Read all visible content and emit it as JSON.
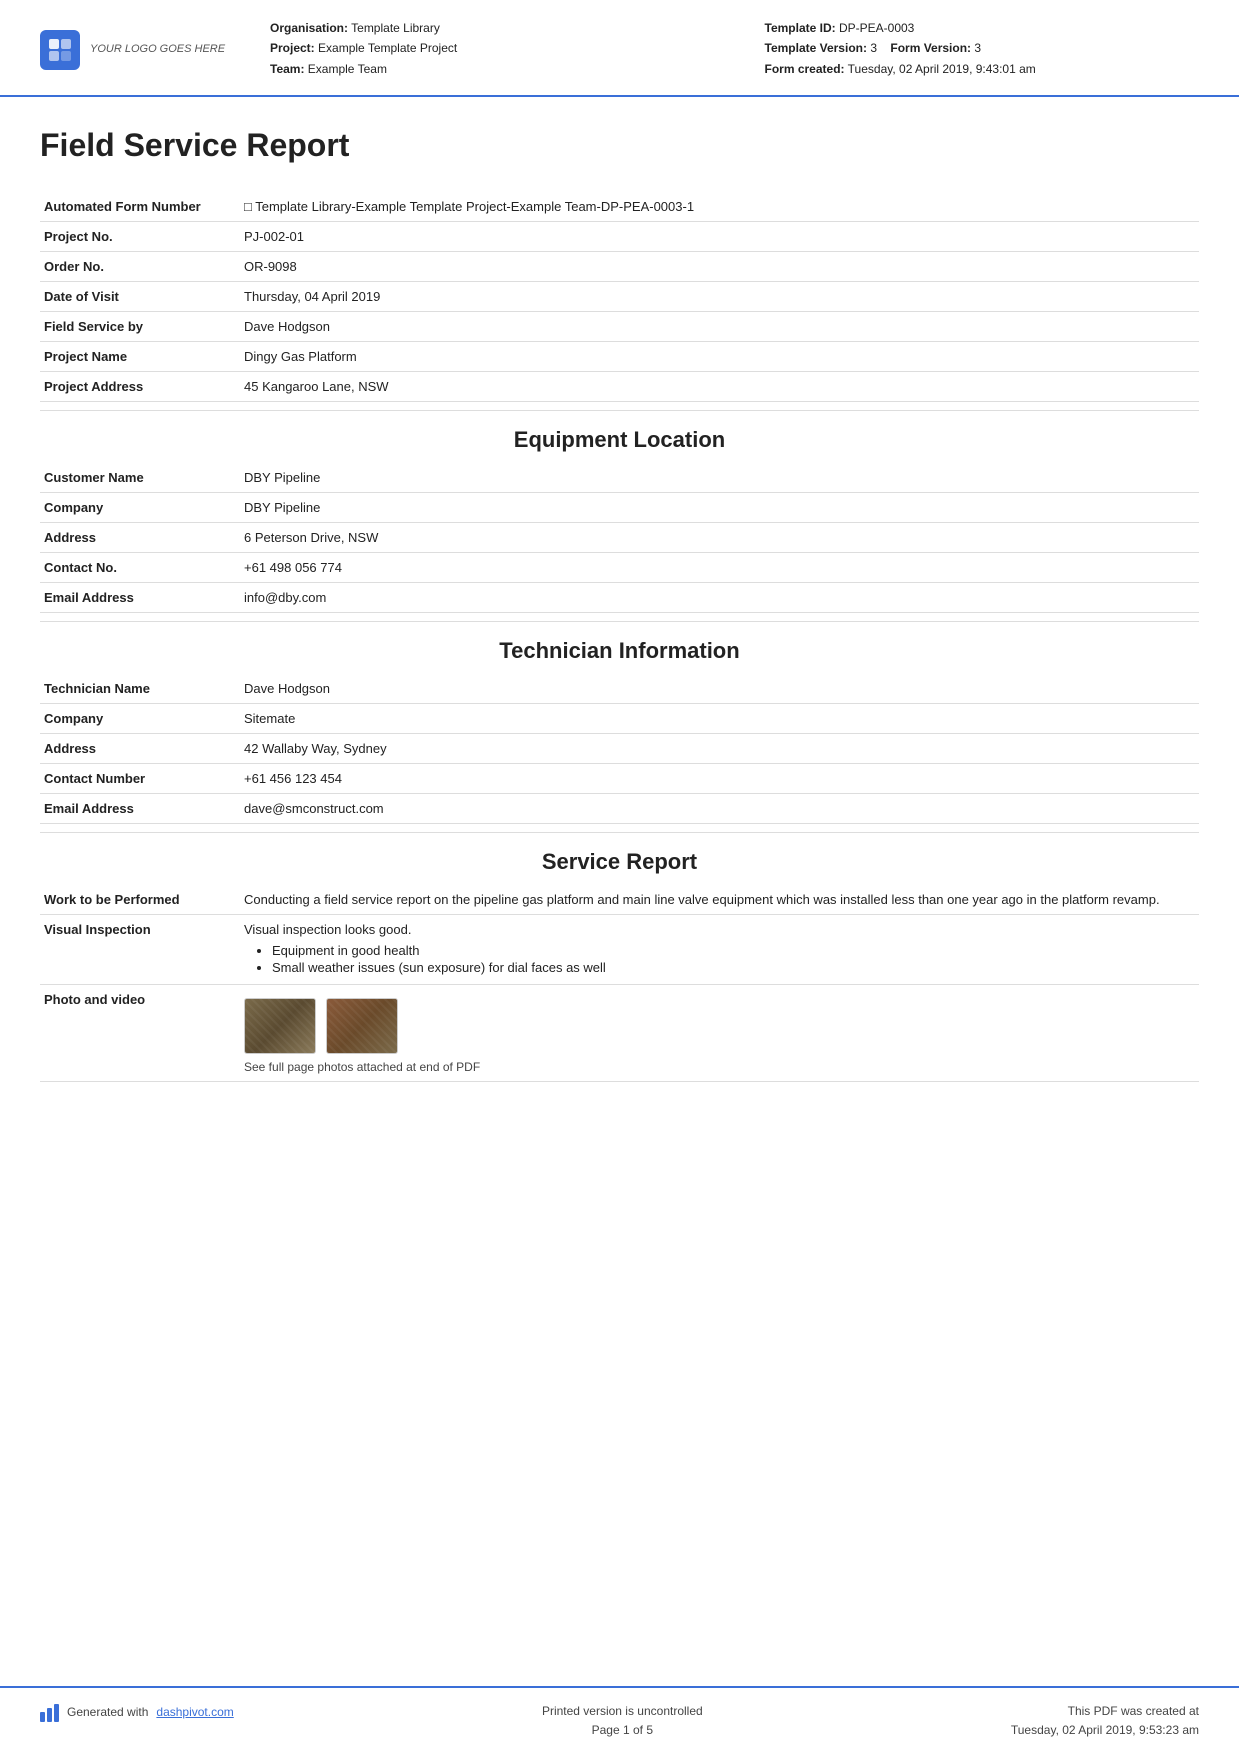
{
  "header": {
    "logo_text": "YOUR LOGO GOES HERE",
    "org_label": "Organisation:",
    "org_value": "Template Library",
    "project_label": "Project:",
    "project_value": "Example Template Project",
    "team_label": "Team:",
    "team_value": "Example Team",
    "template_id_label": "Template ID:",
    "template_id_value": "DP-PEA-0003",
    "template_version_label": "Template Version:",
    "template_version_value": "3",
    "form_version_label": "Form Version:",
    "form_version_value": "3",
    "form_created_label": "Form created:",
    "form_created_value": "Tuesday, 02 April 2019, 9:43:01 am"
  },
  "page_title": "Field Service Report",
  "form_fields": [
    {
      "label": "Automated Form Number",
      "value": "□ Template Library-Example Template Project-Example Team-DP-PEA-0003-1"
    },
    {
      "label": "Project No.",
      "value": "PJ-002-01"
    },
    {
      "label": "Order No.",
      "value": "OR-9098"
    },
    {
      "label": "Date of Visit",
      "value": "Thursday, 04 April 2019"
    },
    {
      "label": "Field Service by",
      "value": "Dave Hodgson"
    },
    {
      "label": "Project Name",
      "value": "Dingy Gas Platform"
    },
    {
      "label": "Project Address",
      "value": "45 Kangaroo Lane, NSW"
    }
  ],
  "section_equipment": "Equipment Location",
  "equipment_fields": [
    {
      "label": "Customer Name",
      "value": "DBY Pipeline"
    },
    {
      "label": "Company",
      "value": "DBY Pipeline"
    },
    {
      "label": "Address",
      "value": "6 Peterson Drive, NSW"
    },
    {
      "label": "Contact No.",
      "value": "+61 498 056 774"
    },
    {
      "label": "Email Address",
      "value": "info@dby.com"
    }
  ],
  "section_technician": "Technician Information",
  "technician_fields": [
    {
      "label": "Technician Name",
      "value": "Dave Hodgson"
    },
    {
      "label": "Company",
      "value": "Sitemate"
    },
    {
      "label": "Address",
      "value": "42 Wallaby Way, Sydney"
    },
    {
      "label": "Contact Number",
      "value": "+61 456 123 454"
    },
    {
      "label": "Email Address",
      "value": "dave@smconstruct.com"
    }
  ],
  "section_service": "Service Report",
  "service_fields": [
    {
      "label": "Work to be Performed",
      "value": "Conducting a field service report on the pipeline gas platform and main line valve equipment which was installed less than one year ago in the platform revamp.",
      "type": "text"
    },
    {
      "label": "Visual Inspection",
      "value": "Visual inspection looks good.",
      "bullets": [
        "Equipment in good health",
        "Small weather issues (sun exposure) for dial faces as well"
      ],
      "type": "bullets"
    },
    {
      "label": "Photo and video",
      "caption": "See full page photos attached at end of PDF",
      "type": "photos"
    }
  ],
  "footer": {
    "generated_text": "Generated with",
    "link_text": "dashpivot.com",
    "center_line1": "Printed version is uncontrolled",
    "center_line2": "Page 1 of 5",
    "right_line1": "This PDF was created at",
    "right_line2": "Tuesday, 02 April 2019, 9:53:23 am"
  }
}
